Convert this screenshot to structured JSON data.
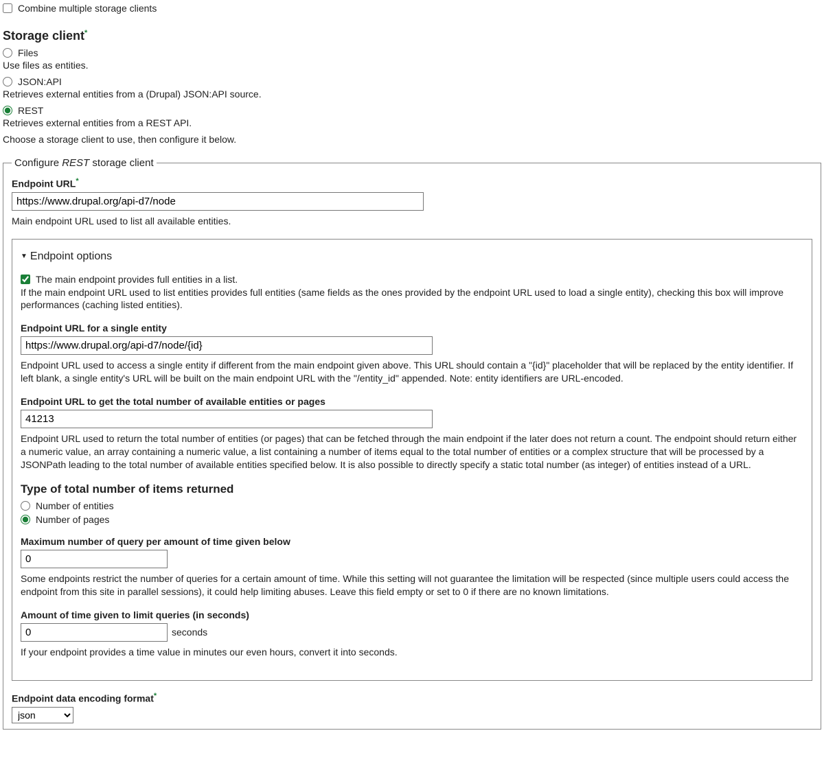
{
  "combine_checkbox": {
    "label": "Combine multiple storage clients",
    "checked": false
  },
  "storage_client": {
    "heading": "Storage client",
    "options": [
      {
        "label": "Files",
        "description": "Use files as entities.",
        "checked": false
      },
      {
        "label": "JSON:API",
        "description": "Retrieves external entities from a (Drupal) JSON:API source.",
        "checked": false
      },
      {
        "label": "REST",
        "description": "Retrieves external entities from a REST API.",
        "checked": true
      }
    ],
    "instruction": "Choose a storage client to use, then configure it below."
  },
  "fieldset": {
    "legend_prefix": "Configure ",
    "legend_italic": "REST",
    "legend_suffix": " storage client",
    "endpoint_url": {
      "label": "Endpoint URL",
      "value": "https://www.drupal.org/api-d7/node",
      "description": "Main endpoint URL used to list all available entities."
    },
    "endpoint_options": {
      "summary": "Endpoint options",
      "full_entities": {
        "label": "The main endpoint provides full entities in a list.",
        "checked": true,
        "description": "If the main endpoint URL used to list entities provides full entities (same fields as the ones provided by the endpoint URL used to load a single entity), checking this box will improve performances (caching listed entities)."
      },
      "single_entity": {
        "label": "Endpoint URL for a single entity",
        "value": "https://www.drupal.org/api-d7/node/{id}",
        "description": "Endpoint URL used to access a single entity if different from the main endpoint given above. This URL should contain a \"{id}\" placeholder that will be replaced by the entity identifier. If left blank, a single entity's URL will be built on the main endpoint URL with the \"/entity_id\" appended. Note: entity identifiers are URL-encoded."
      },
      "count_url": {
        "label": "Endpoint URL to get the total number of available entities or pages",
        "value": "41213",
        "description": "Endpoint URL used to return the total number of entities (or pages) that can be fetched through the main endpoint if the later does not return a count. The endpoint should return either a numeric value, an array containing a numeric value, a list containing a number of items equal to the total number of entities or a complex structure that will be processed by a JSONPath leading to the total number of available entities specified below. It is also possible to directly specify a static total number (as integer) of entities instead of a URL."
      },
      "total_type": {
        "heading": "Type of total number of items returned",
        "options": [
          {
            "label": "Number of entities",
            "checked": false
          },
          {
            "label": "Number of pages",
            "checked": true
          }
        ]
      },
      "max_query": {
        "label": "Maximum number of query per amount of time given below",
        "value": "0",
        "description": "Some endpoints restrict the number of queries for a certain amount of time. While this setting will not guarantee the limitation will be respected (since multiple users could access the endpoint from this site in parallel sessions), it could help limiting abuses. Leave this field empty or set to 0 if there are no known limitations."
      },
      "time_limit": {
        "label": "Amount of time given to limit queries (in seconds)",
        "value": "0",
        "suffix": "seconds",
        "description": "If your endpoint provides a time value in minutes our even hours, convert it into seconds."
      }
    },
    "encoding": {
      "label": "Endpoint data encoding format",
      "value": "json"
    }
  }
}
